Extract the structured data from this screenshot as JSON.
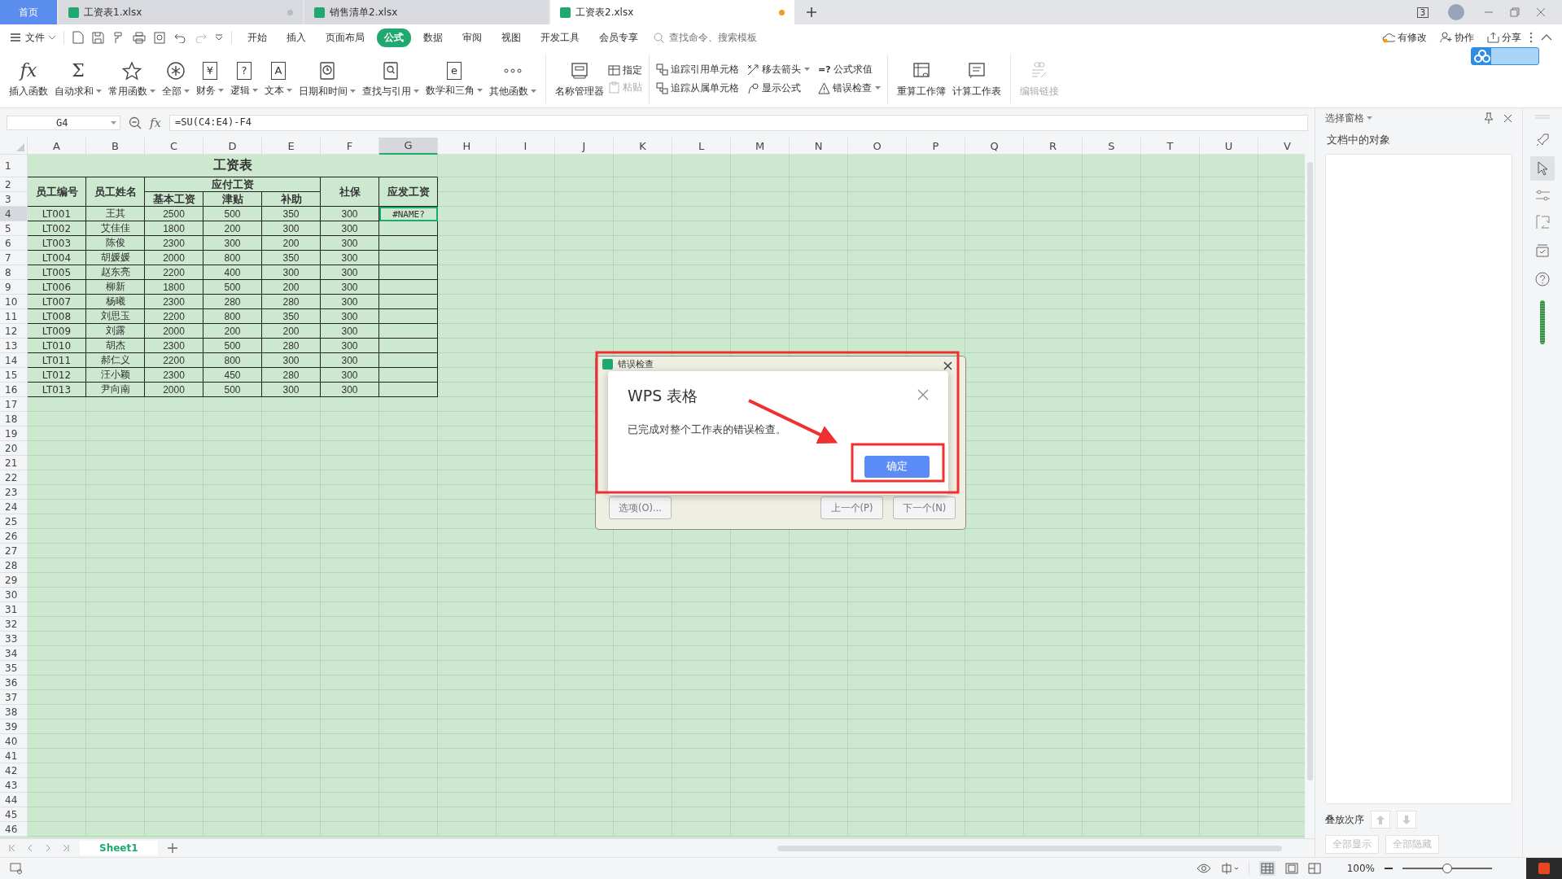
{
  "tabs": [
    {
      "label": "首页",
      "kind": "home",
      "selected": false
    },
    {
      "label": "工资表1.xlsx",
      "kind": "file",
      "selected": false,
      "color": "#b8bcc4"
    },
    {
      "label": "销售清单2.xlsx",
      "kind": "file",
      "selected": false
    },
    {
      "label": "工资表2.xlsx",
      "kind": "file",
      "selected": true,
      "color": "#f29b1d"
    }
  ],
  "window_count": "3",
  "menu": {
    "file": "文件",
    "items": [
      {
        "label": "开始",
        "selected": false
      },
      {
        "label": "插入",
        "selected": false
      },
      {
        "label": "页面布局",
        "selected": false
      },
      {
        "label": "公式",
        "selected": true
      },
      {
        "label": "数据",
        "selected": false
      },
      {
        "label": "审阅",
        "selected": false
      },
      {
        "label": "视图",
        "selected": false
      },
      {
        "label": "开发工具",
        "selected": false
      },
      {
        "label": "会员专享",
        "selected": false
      }
    ],
    "search": {
      "placeholder": "查找命令、搜索模板"
    },
    "actions": [
      "有修改",
      "协作",
      "分享"
    ]
  },
  "ribbon": {
    "functions": [
      {
        "label": "插入函数",
        "kind": "glyph",
        "glyph": "fx",
        "dropdown": false
      },
      {
        "label": "自动求和",
        "kind": "glyph",
        "glyph": "Σ",
        "dropdown": true
      },
      {
        "label": "常用函数",
        "kind": "star",
        "dropdown": true
      },
      {
        "label": "全部",
        "kind": "asterisk",
        "dropdown": true
      },
      {
        "label": "财务",
        "kind": "boxed",
        "glyph": "¥",
        "dropdown": true
      },
      {
        "label": "逻辑",
        "kind": "boxed",
        "glyph": "?",
        "dropdown": true
      },
      {
        "label": "文本",
        "kind": "boxed",
        "glyph": "A",
        "dropdown": true
      },
      {
        "label": "日期和时间",
        "kind": "clock",
        "dropdown": true
      },
      {
        "label": "查找与引用",
        "kind": "search",
        "dropdown": true
      },
      {
        "label": "数学和三角",
        "kind": "boxed",
        "glyph": "e",
        "dropdown": true
      },
      {
        "label": "其他函数",
        "kind": "dots",
        "dropdown": true
      }
    ],
    "names": {
      "label": "名称管理器",
      "small": [
        {
          "label": "指定",
          "disabled": false
        },
        {
          "label": "粘贴",
          "disabled": true
        }
      ]
    },
    "audit": [
      {
        "label": "追踪引用单元格",
        "kind": "trace",
        "dropdown": false
      },
      {
        "label": "追踪从属单元格",
        "kind": "trace",
        "dropdown": false
      },
      {
        "label": "移去箭头",
        "kind": "remove",
        "dropdown": true
      },
      {
        "label": "显示公式",
        "kind": "formula",
        "dropdown": false
      },
      {
        "label": "公式求值",
        "kind": "glyph",
        "glyph": "=?",
        "dropdown": false
      },
      {
        "label": "错误检查",
        "kind": "warning",
        "dropdown": true
      }
    ],
    "calc": [
      "重算工作簿",
      "计算工作表"
    ],
    "links": {
      "label": "编辑链接",
      "disabled": true
    }
  },
  "formula_bar": {
    "fx_glyph": "fx",
    "name_box": "G4",
    "formula": "=SU(C4:E4)-F4"
  },
  "sheet": {
    "columns": [
      {
        "label": "A",
        "selected": false
      },
      {
        "label": "B",
        "selected": false
      },
      {
        "label": "C",
        "selected": false
      },
      {
        "label": "D",
        "selected": false
      },
      {
        "label": "E",
        "selected": false
      },
      {
        "label": "F",
        "selected": false
      },
      {
        "label": "G",
        "selected": true
      },
      {
        "label": "H",
        "selected": false
      },
      {
        "label": "I",
        "selected": false
      },
      {
        "label": "J",
        "selected": false
      },
      {
        "label": "K",
        "selected": false
      },
      {
        "label": "L",
        "selected": false
      },
      {
        "label": "M",
        "selected": false
      },
      {
        "label": "N",
        "selected": false
      },
      {
        "label": "O",
        "selected": false
      },
      {
        "label": "P",
        "selected": false
      },
      {
        "label": "Q",
        "selected": false
      },
      {
        "label": "R",
        "selected": false
      },
      {
        "label": "S",
        "selected": false
      },
      {
        "label": "T",
        "selected": false
      },
      {
        "label": "U",
        "selected": false
      },
      {
        "label": "V",
        "selected": false
      }
    ],
    "rows": [
      {
        "label": "1",
        "selected": false
      },
      {
        "label": "2",
        "selected": false
      },
      {
        "label": "3",
        "selected": false
      },
      {
        "label": "4",
        "selected": true
      },
      {
        "label": "5",
        "selected": false
      },
      {
        "label": "6",
        "selected": false
      },
      {
        "label": "7",
        "selected": false
      },
      {
        "label": "8",
        "selected": false
      },
      {
        "label": "9",
        "selected": false
      },
      {
        "label": "10",
        "selected": false
      },
      {
        "label": "11",
        "selected": false
      },
      {
        "label": "12",
        "selected": false
      },
      {
        "label": "13",
        "selected": false
      },
      {
        "label": "14",
        "selected": false
      },
      {
        "label": "15",
        "selected": false
      },
      {
        "label": "16",
        "selected": false
      },
      {
        "label": "17",
        "selected": false
      },
      {
        "label": "18",
        "selected": false
      },
      {
        "label": "19",
        "selected": false
      },
      {
        "label": "20",
        "selected": false
      },
      {
        "label": "21",
        "selected": false
      },
      {
        "label": "22",
        "selected": false
      },
      {
        "label": "23",
        "selected": false
      },
      {
        "label": "24",
        "selected": false
      },
      {
        "label": "25",
        "selected": false
      },
      {
        "label": "26",
        "selected": false
      },
      {
        "label": "27",
        "selected": false
      },
      {
        "label": "28",
        "selected": false
      },
      {
        "label": "29",
        "selected": false
      },
      {
        "label": "30",
        "selected": false
      },
      {
        "label": "31",
        "selected": false
      },
      {
        "label": "32",
        "selected": false
      },
      {
        "label": "33",
        "selected": false
      },
      {
        "label": "34",
        "selected": false
      },
      {
        "label": "35",
        "selected": false
      },
      {
        "label": "36",
        "selected": false
      },
      {
        "label": "37",
        "selected": false
      },
      {
        "label": "38",
        "selected": false
      },
      {
        "label": "39",
        "selected": false
      },
      {
        "label": "40",
        "selected": false
      },
      {
        "label": "41",
        "selected": false
      },
      {
        "label": "42",
        "selected": false
      },
      {
        "label": "43",
        "selected": false
      },
      {
        "label": "44",
        "selected": false
      },
      {
        "label": "45",
        "selected": false
      },
      {
        "label": "46",
        "selected": false
      }
    ],
    "title": "工资表",
    "headers": [
      {
        "text": "员工编号"
      },
      {
        "text": "员工姓名"
      },
      {
        "text": "应付工资",
        "children": [
          {
            "text": "基本工资"
          },
          {
            "text": "津贴"
          },
          {
            "text": "补助"
          }
        ]
      },
      {
        "text": "社保"
      },
      {
        "text": "应发工资"
      }
    ],
    "data": [
      [
        "LT001",
        "王其",
        "2500",
        "500",
        "350",
        "300",
        "#NAME?"
      ],
      [
        "LT002",
        "艾佳佳",
        "1800",
        "200",
        "300",
        "300"
      ],
      [
        "LT003",
        "陈俊",
        "2300",
        "300",
        "200",
        "300"
      ],
      [
        "LT004",
        "胡媛媛",
        "2000",
        "800",
        "350",
        "300"
      ],
      [
        "LT005",
        "赵东亮",
        "2200",
        "400",
        "300",
        "300"
      ],
      [
        "LT006",
        "柳新",
        "1800",
        "500",
        "200",
        "300"
      ],
      [
        "LT007",
        "杨曦",
        "2300",
        "280",
        "280",
        "300"
      ],
      [
        "LT008",
        "刘思玉",
        "2200",
        "800",
        "350",
        "300"
      ],
      [
        "LT009",
        "刘露",
        "2000",
        "200",
        "200",
        "300"
      ],
      [
        "LT010",
        "胡杰",
        "2300",
        "500",
        "280",
        "300"
      ],
      [
        "LT011",
        "郝仁义",
        "2200",
        "800",
        "300",
        "300"
      ],
      [
        "LT012",
        "汪小颖",
        "2300",
        "450",
        "280",
        "300"
      ],
      [
        "LT013",
        "尹向南",
        "2000",
        "500",
        "300",
        "300"
      ]
    ]
  },
  "sheet_tabs": [
    {
      "label": "Sheet1",
      "selected": true
    }
  ],
  "pane": {
    "title": "选择窗格",
    "heading": "文档中的对象",
    "order_label": "叠放次序",
    "buttons": [
      {
        "label": "全部显示",
        "disabled": true
      },
      {
        "label": "全部隐藏",
        "disabled": true
      }
    ]
  },
  "status_bar": {
    "zoom": "100%",
    "zoom_slider": {
      "level": 0.5
    }
  },
  "error_check_window": {
    "title": "错误检查",
    "buttons": [
      "选项(O)...",
      "上一个(P)",
      "下一个(N)"
    ]
  },
  "message_box": {
    "title": "WPS 表格",
    "message": "已完成对整个工作表的错误检查。",
    "button": "确定"
  }
}
